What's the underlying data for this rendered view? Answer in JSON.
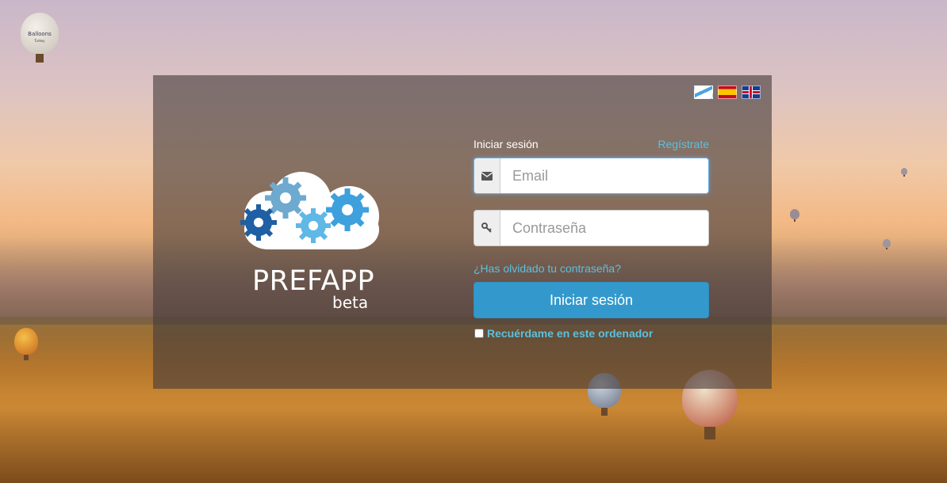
{
  "colors": {
    "accent": "#5bc0de",
    "primary_button": "#3399cc",
    "card_overlay": "rgba(70,60,58,0.62)"
  },
  "languages": [
    {
      "name": "Galego",
      "icon": "flag-galicia-icon"
    },
    {
      "name": "Español",
      "icon": "flag-spain-icon"
    },
    {
      "name": "English",
      "icon": "flag-uk-icon"
    }
  ],
  "brand": {
    "name": "PREFAPP",
    "tag": "beta",
    "icon": "cloud-gears-logo"
  },
  "balloon_badge": {
    "text_line1": "Balloons",
    "text_line2": "Turkey"
  },
  "login": {
    "title": "Iniciar sesión",
    "register_label": "Regístrate",
    "email_placeholder": "Email",
    "email_icon": "envelope-icon",
    "password_placeholder": "Contraseña",
    "password_icon": "key-icon",
    "forgot_label": "¿Has olvidado tu contraseña?",
    "submit_label": "Iniciar sesión",
    "remember_label": "Recuérdame en este ordenador"
  }
}
